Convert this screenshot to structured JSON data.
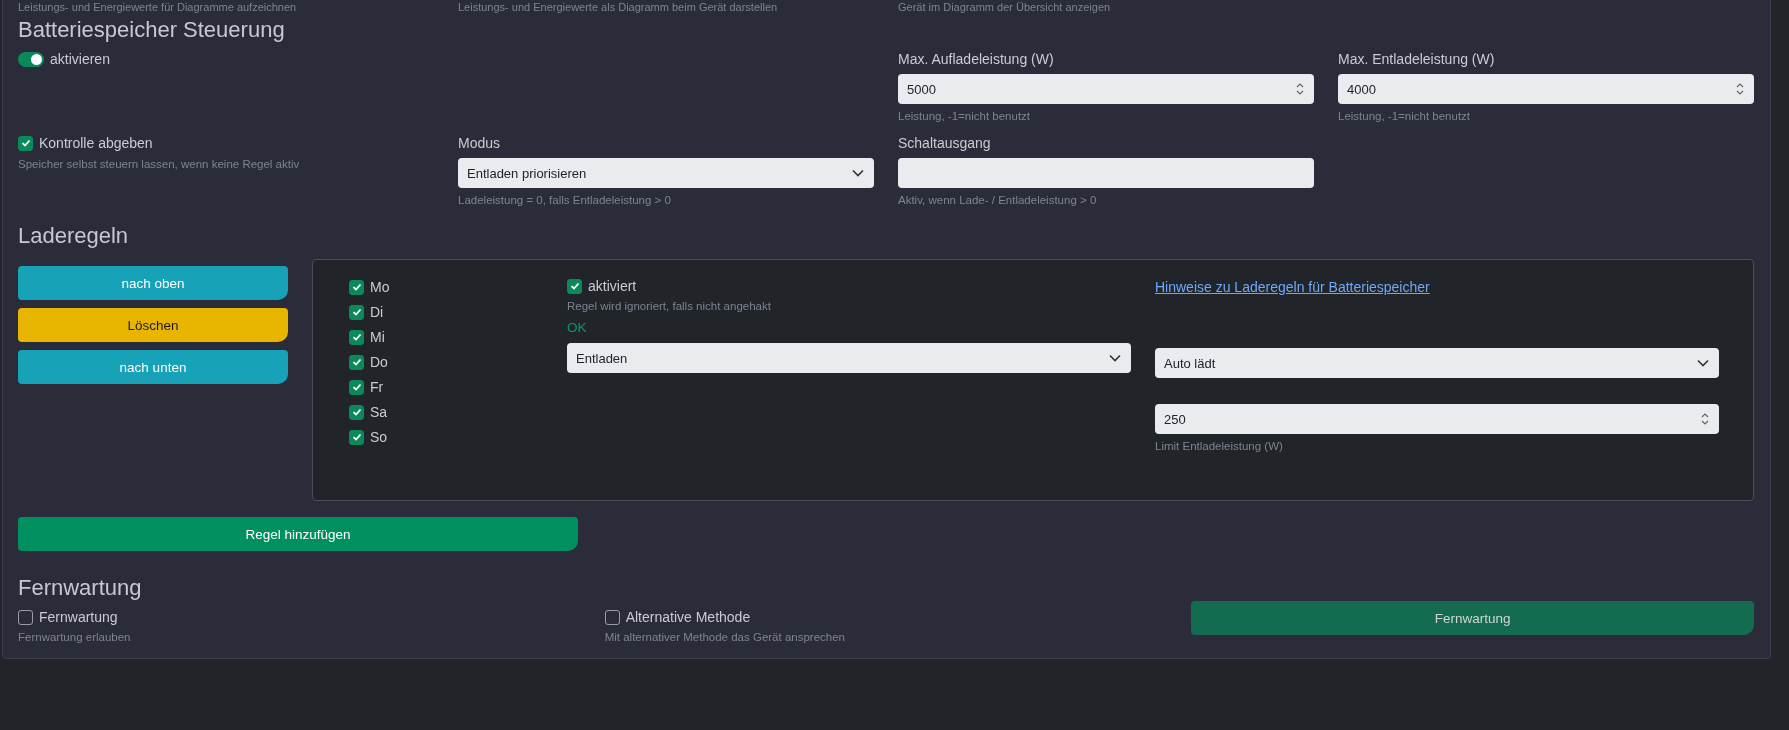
{
  "top_hints": [
    "Leistungs- und Energiewerte für Diagramme aufzeichnen",
    "Leistungs- und Energiewerte als Diagramm beim Gerät darstellen",
    "Gerät im Diagramm der Übersicht anzeigen"
  ],
  "battery": {
    "title": "Batteriespeicher Steuerung",
    "enable": {
      "label": "aktivieren",
      "on": true
    },
    "max_charge": {
      "label": "Max. Aufladeleistung (W)",
      "value": "5000",
      "hint": "Leistung, -1=nicht benutzt"
    },
    "max_discharge": {
      "label": "Max. Entladeleistung (W)",
      "value": "4000",
      "hint": "Leistung, -1=nicht benutzt"
    },
    "release_control": {
      "label": "Kontrolle abgeben",
      "checked": true,
      "hint": "Speicher selbst steuern lassen, wenn keine Regel aktiv"
    },
    "mode": {
      "label": "Modus",
      "value": "Entladen priorisieren",
      "hint": "Ladeleistung = 0, falls Entladeleistung > 0"
    },
    "switch_output": {
      "label": "Schaltausgang",
      "hint": "Aktiv, wenn Lade- / Entladeleistung > 0"
    }
  },
  "charge_rules": {
    "title": "Laderegeln",
    "buttons": [
      {
        "label": "nach oben",
        "kind": "move"
      },
      {
        "label": "Löschen",
        "kind": "delete"
      },
      {
        "label": "nach unten",
        "kind": "move"
      }
    ],
    "rule": {
      "days": [
        {
          "label": "Mo",
          "checked": true
        },
        {
          "label": "Di",
          "checked": true
        },
        {
          "label": "Mi",
          "checked": true
        },
        {
          "label": "Do",
          "checked": true
        },
        {
          "label": "Fr",
          "checked": true
        },
        {
          "label": "Sa",
          "checked": true
        },
        {
          "label": "So",
          "checked": true
        }
      ],
      "active": {
        "label": "aktiviert",
        "checked": true,
        "hint": "Regel wird ignoriert, falls nicht angehakt"
      },
      "status": "OK",
      "action": "Entladen",
      "link": "Hinweise zu Laderegeln für Batteriespeicher",
      "trigger": "Auto lädt",
      "limit": {
        "value": "250",
        "hint": "Limit Entladeleistung (W)"
      }
    },
    "add_button": "Regel hinzufügen"
  },
  "remote": {
    "title": "Fernwartung",
    "options": [
      {
        "label": "Fernwartung",
        "checked": false,
        "hint": "Fernwartung erlauben"
      },
      {
        "label": "Alternative Methode",
        "checked": false,
        "hint": "Mit alternativer Methode das Gerät ansprechen"
      }
    ],
    "button": {
      "label": "Fernwartung",
      "disabled": true
    }
  }
}
